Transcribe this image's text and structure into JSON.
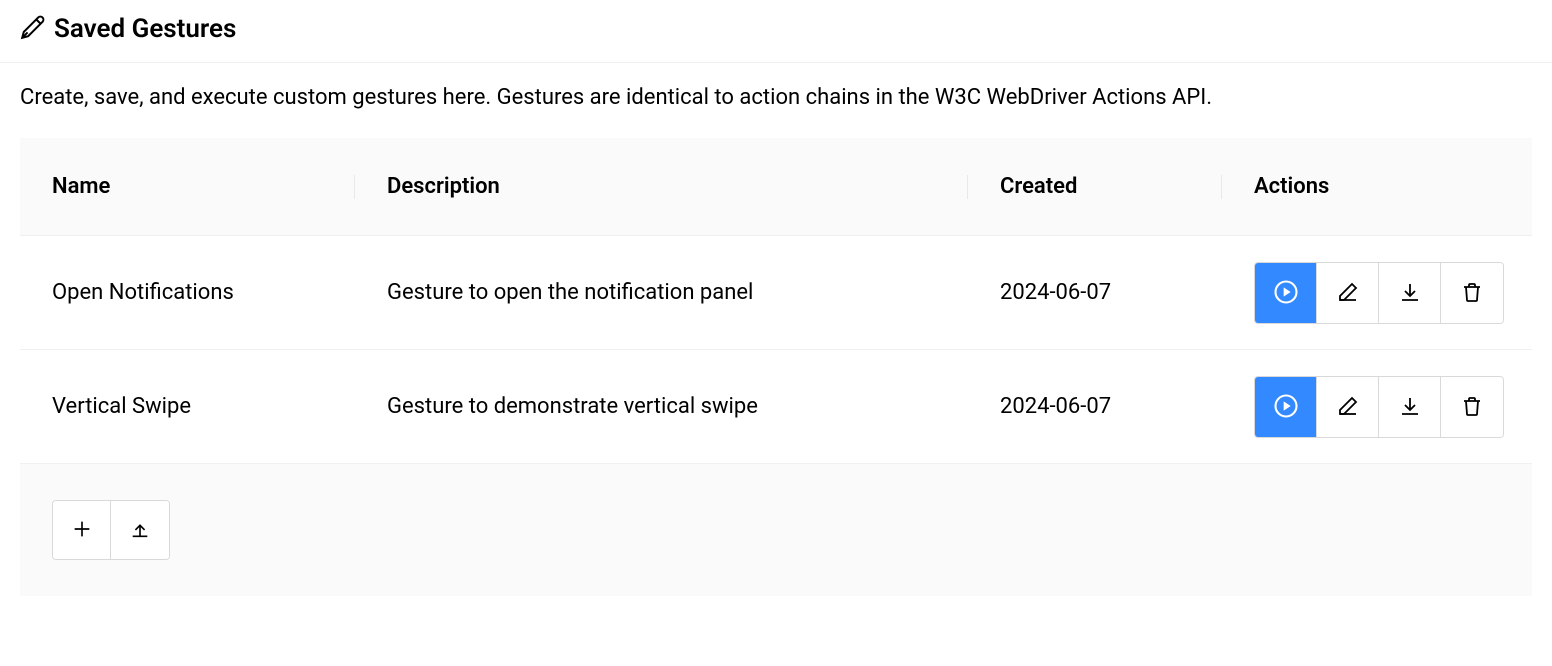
{
  "header": {
    "title": "Saved Gestures"
  },
  "description": "Create, save, and execute custom gestures here. Gestures are identical to action chains in the W3C WebDriver Actions API.",
  "table": {
    "columns": {
      "name": "Name",
      "description": "Description",
      "created": "Created",
      "actions": "Actions"
    },
    "rows": [
      {
        "name": "Open Notifications",
        "description": "Gesture to open the notification panel",
        "created": "2024-06-07"
      },
      {
        "name": "Vertical Swipe",
        "description": "Gesture to demonstrate vertical swipe",
        "created": "2024-06-07"
      }
    ]
  }
}
